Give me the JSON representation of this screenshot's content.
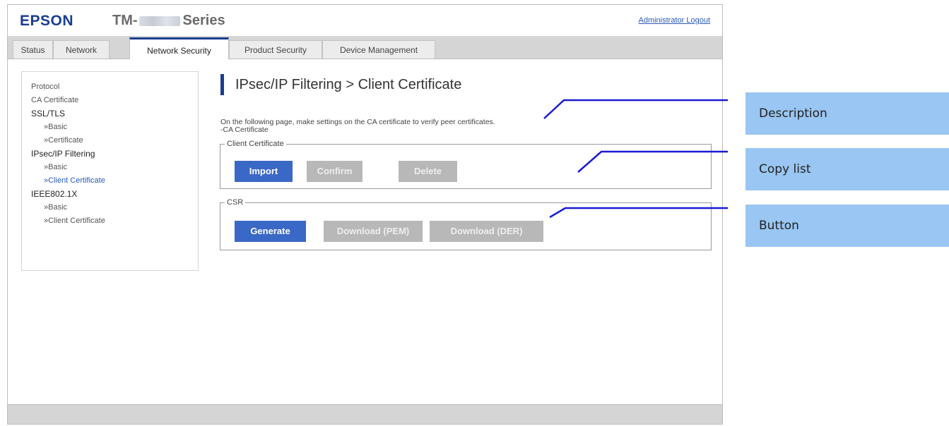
{
  "header": {
    "brand": "EPSON",
    "model_prefix": "TM-",
    "model_suffix": "Series",
    "logout_label": "Administrator Logout"
  },
  "tabs": [
    {
      "label": "Status",
      "active": false
    },
    {
      "label": "Network",
      "active": false
    },
    {
      "label": "Network Security",
      "active": true
    },
    {
      "label": "Product Security",
      "active": false
    },
    {
      "label": "Device Management",
      "active": false
    }
  ],
  "sidebar": {
    "items": [
      {
        "label": "Protocol"
      },
      {
        "label": "CA Certificate"
      },
      {
        "label": "SSL/TLS"
      },
      {
        "label": "»Basic"
      },
      {
        "label": "»Certificate"
      },
      {
        "label": "IPsec/IP Filtering"
      },
      {
        "label": "»Basic"
      },
      {
        "label": "»Client Certificate"
      },
      {
        "label": "IEEE802.1X"
      },
      {
        "label": "»Basic"
      },
      {
        "label": "»Client Certificate"
      }
    ]
  },
  "main": {
    "title": "IPsec/IP Filtering > Client Certificate",
    "description_line1": "On the following page, make settings on the CA certificate to verify peer certificates.",
    "description_line2": "-CA Certificate",
    "client_certificate": {
      "legend": "Client Certificate",
      "import_label": "Import",
      "confirm_label": "Confirm",
      "delete_label": "Delete"
    },
    "csr": {
      "legend": "CSR",
      "generate_label": "Generate",
      "download_pem_label": "Download (PEM)",
      "download_der_label": "Download (DER)"
    }
  },
  "callouts": {
    "description": "Description",
    "copy_list": "Copy list",
    "button": "Button"
  },
  "colors": {
    "brand": "#1a3d8f",
    "primary_button": "#3a68c6",
    "disabled_button": "#b8b8b8",
    "callout_bg": "#99c6f2",
    "callout_line": "#1a1ad6"
  }
}
